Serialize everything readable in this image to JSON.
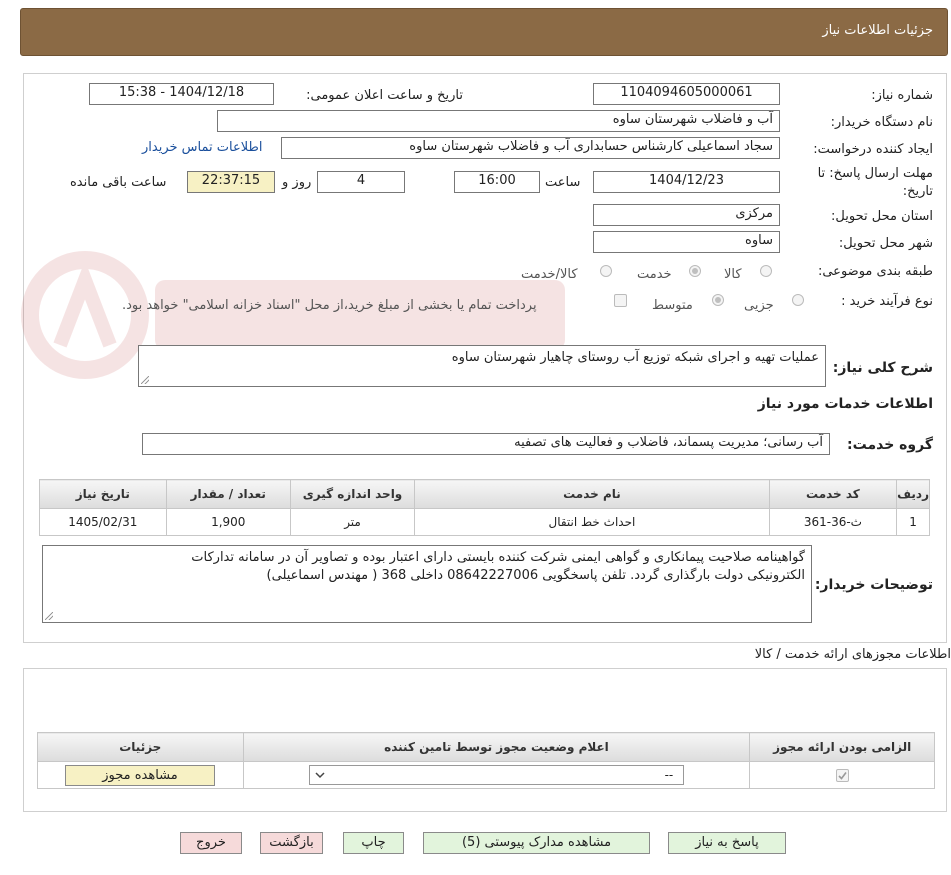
{
  "header": {
    "title": "جزئیات اطلاعات نیاز"
  },
  "form": {
    "need_number_label": "شماره نیاز:",
    "need_number": "1104094605000061",
    "announce_label": "تاریخ و ساعت اعلان عمومی:",
    "announce_value": "1404/12/18 - 15:38",
    "buyer_org_label": "نام دستگاه خریدار:",
    "buyer_org": "آب و فاضلاب شهرستان ساوه",
    "creator_label": "ایجاد کننده درخواست:",
    "creator": "سجاد اسماعیلی کارشناس حسابداری آب و فاضلاب شهرستان ساوه",
    "contact_link": "اطلاعات تماس خریدار",
    "deadline_label_1": "مهلت ارسال پاسخ: تا",
    "deadline_label_2": "تاریخ:",
    "deadline_date": "1404/12/23",
    "hour_label": "ساعت",
    "deadline_time": "16:00",
    "days_value": "4",
    "days_label": "روز و",
    "remaining_time": "22:37:15",
    "remaining_label": "ساعت باقی مانده",
    "province_label": "استان محل تحویل:",
    "province": "مرکزی",
    "city_label": "شهر محل تحویل:",
    "city": "ساوه",
    "category_label": "طبقه بندی موضوعی:",
    "category_options": [
      "کالا",
      "خدمت",
      "کالا/خدمت"
    ],
    "category_selected": "خدمت",
    "process_label": "نوع فرآیند خرید :",
    "process_options": [
      "جزیی",
      "متوسط"
    ],
    "process_selected": "متوسط",
    "treasury_note": "پرداخت تمام یا بخشی از مبلغ خرید،از محل \"اسناد خزانه اسلامی\" خواهد بود."
  },
  "summary": {
    "label": "شرح کلی نیاز:",
    "text": "عملیات تهیه و اجرای شبکه توزیع آب روستای چاهیار شهرستان ساوه"
  },
  "services": {
    "section_title": "اطلاعات خدمات مورد نیاز",
    "group_label": "گروه خدمت:",
    "group_value": "آب رسانی؛ مدیریت پسماند، فاضلاب و فعالیت های تصفیه",
    "columns": [
      "ردیف",
      "کد خدمت",
      "نام خدمت",
      "واحد اندازه گیری",
      "تعداد / مقدار",
      "تاریخ نیاز"
    ],
    "rows": [
      {
        "row": "1",
        "code": "ث-36-361",
        "name": "احداث خط انتقال",
        "unit": "متر",
        "qty": "1,900",
        "date": "1405/02/31"
      }
    ]
  },
  "buyer_notes": {
    "label": "توضیحات خریدار:",
    "line1": "گواهینامه صلاحیت پیمانکاری و گواهی ایمنی شرکت کننده بایستی دارای اعتبار بوده و تصاویر آن در سامانه تدارکات",
    "line2": "الکترونیکی دولت بارگذاری گردد. تلفن پاسخگویی 08642227006 داخلی 368 ( مهندس اسماعیلی)"
  },
  "permits": {
    "section_title": "اطلاعات مجوزهای ارائه خدمت / کالا",
    "columns": [
      "الزامی بودن ارائه مجوز",
      "اعلام وضعیت مجوز توسط تامین کننده",
      "جزئیات"
    ],
    "select_value": "--",
    "view_button": "مشاهده مجوز"
  },
  "buttons": {
    "reply": "پاسخ به نیاز",
    "attachments": "مشاهده مدارک پیوستی (5)",
    "print": "چاپ",
    "back": "بازگشت",
    "exit": "خروج"
  }
}
